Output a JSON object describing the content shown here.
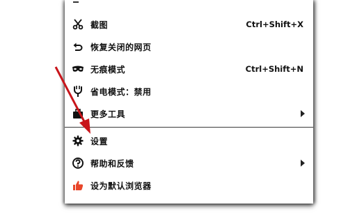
{
  "menu": {
    "items": [
      {
        "label": "截图",
        "shortcut": "Ctrl+Shift+X",
        "icon": "scissors-icon"
      },
      {
        "label": "恢复关闭的网页",
        "shortcut": "",
        "icon": "undo-icon"
      },
      {
        "label": "无痕模式",
        "shortcut": "Ctrl+Shift+N",
        "icon": "incognito-mask-icon"
      },
      {
        "label": "省电模式：禁用",
        "shortcut": "",
        "icon": "power-plug-icon"
      },
      {
        "label": "更多工具",
        "shortcut": "",
        "icon": "toolbox-icon",
        "has_submenu": true
      },
      {
        "label": "设置",
        "shortcut": "",
        "icon": "gear-icon"
      },
      {
        "label": "帮助和反馈",
        "shortcut": "",
        "icon": "question-circle-icon",
        "has_submenu": true
      },
      {
        "label": "设为默认浏览器",
        "shortcut": "",
        "icon": "thumbs-up-icon"
      }
    ]
  },
  "colors": {
    "menu_background": "#ffffff",
    "text": "#111111",
    "divider": "#3a3a3a",
    "annotation_arrow": "#c8151b",
    "thumbs_up": "#e8462a"
  }
}
